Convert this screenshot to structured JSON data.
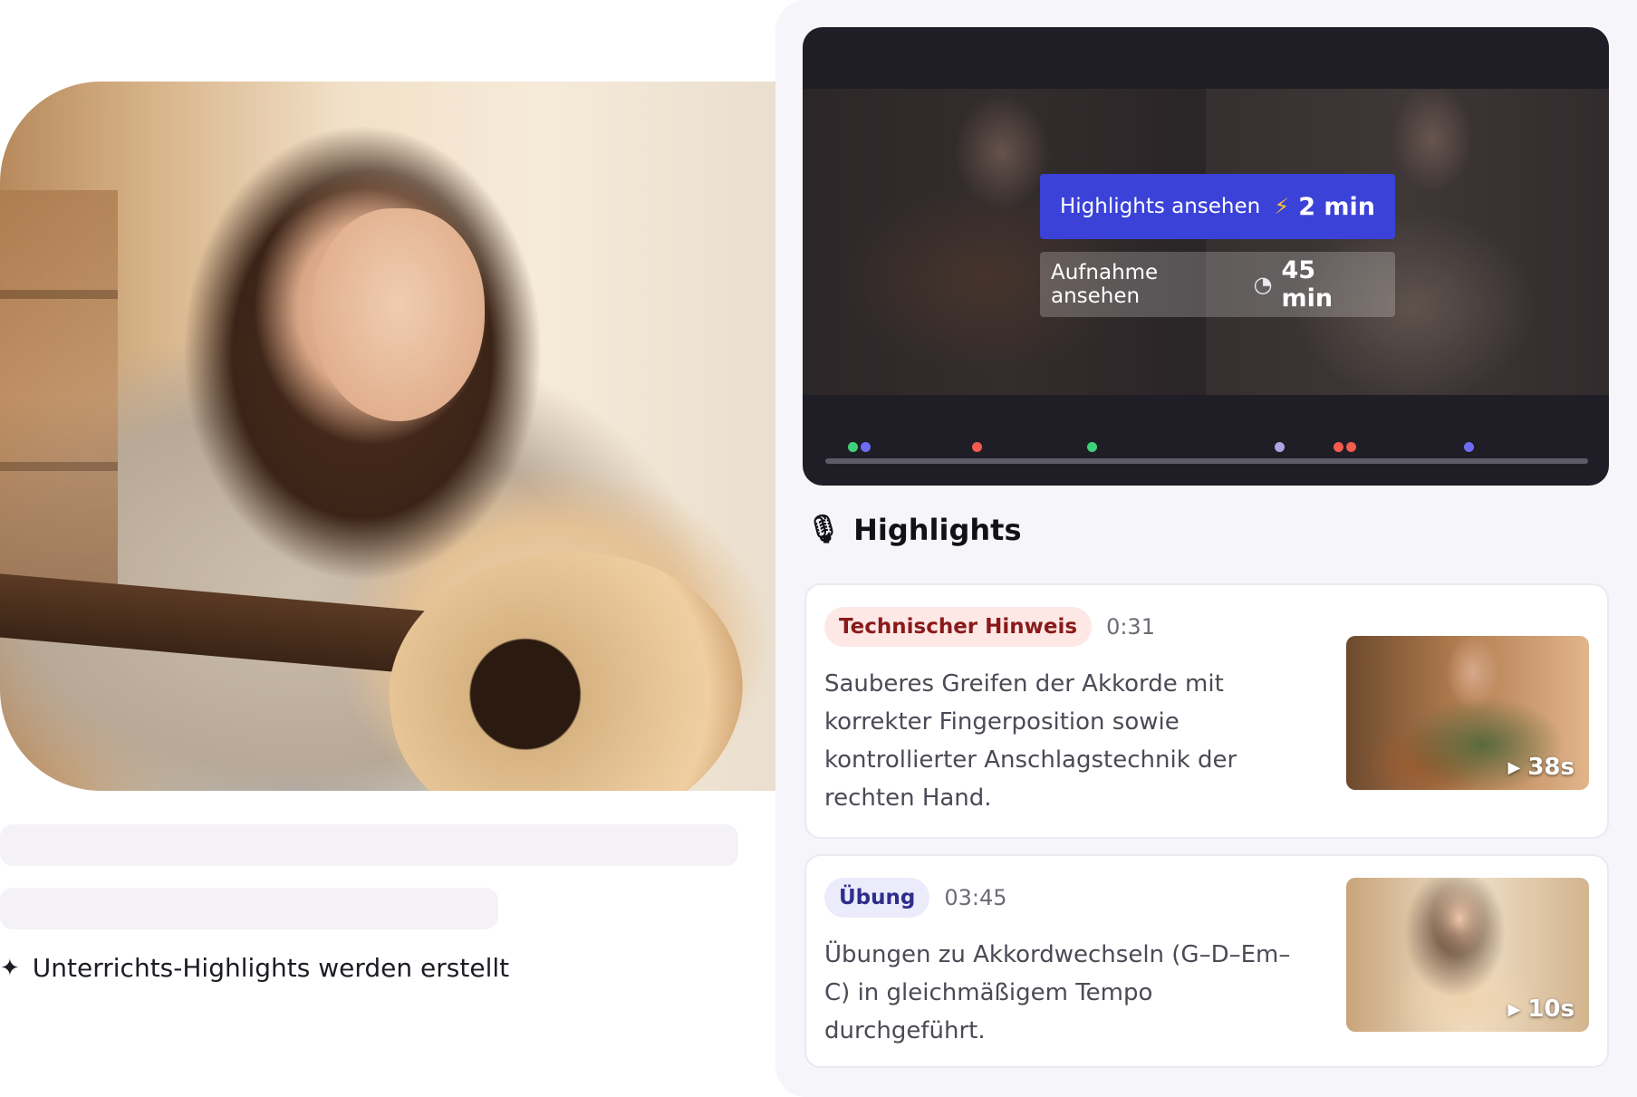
{
  "left": {
    "status_text": "Unterrichts-Highlights werden erstellt"
  },
  "player": {
    "highlights_button": {
      "label": "Highlights ansehen",
      "duration": "2 min",
      "icon": "lightning-icon"
    },
    "recording_button": {
      "label": "Aufnahme ansehen",
      "duration": "45 min",
      "icon": "pie-timer-icon"
    },
    "timeline_markers": [
      {
        "color": "#3ed07a"
      },
      {
        "color": "#6c6cf5"
      },
      {
        "color": "#f25b4f"
      },
      {
        "color": "#3ed07a"
      },
      {
        "color": "#a9a6e0"
      },
      {
        "color": "#f25b4f"
      },
      {
        "color": "#f25b4f"
      },
      {
        "color": "#6c6cf5"
      }
    ]
  },
  "highlights": {
    "title": "Highlights",
    "icon": "microphone-icon",
    "items": [
      {
        "tag": "Technischer Hinweis",
        "tag_color": "#fde8e6",
        "time": "0:31",
        "description": "Sauberes Greifen der Akkorde mit korrekter Fingerposition sowie kontrollierter Anschlagstechnik der rechten Hand.",
        "clip_duration": "38s"
      },
      {
        "tag": "Übung",
        "tag_color": "#ecebfb",
        "time": "03:45",
        "description": "Übungen zu Akkordwechseln (G–D–Em–C) in gleichmäßigem Tempo durchgeführt.",
        "clip_duration": "10s"
      }
    ]
  },
  "colors": {
    "accent": "#3b42d8",
    "panel_bg": "#f6f5fa",
    "player_bg": "#1f1e26"
  }
}
